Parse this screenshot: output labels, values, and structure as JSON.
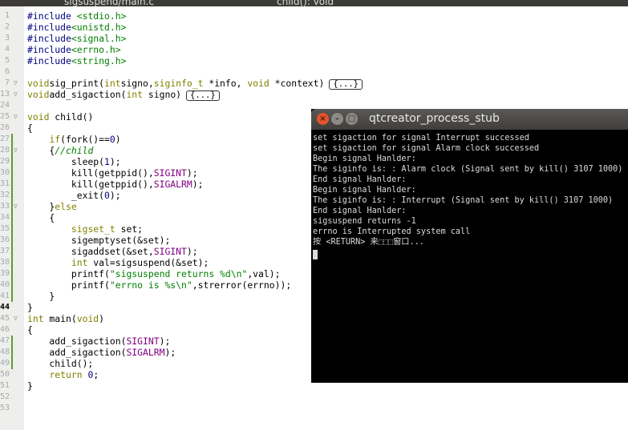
{
  "top_bar": {
    "file_tab": "sigsuspend/main.c",
    "symbol_tab": "child(): void"
  },
  "editor": {
    "collapsed_marker": "{...}",
    "lines": [
      {
        "n": "1",
        "t": [
          [
            "pp",
            "#include "
          ],
          [
            "str",
            "<stdio.h>"
          ]
        ]
      },
      {
        "n": "2",
        "t": [
          [
            "pp",
            "#include"
          ],
          [
            "str",
            "<unistd.h>"
          ]
        ]
      },
      {
        "n": "3",
        "t": [
          [
            "pp",
            "#include"
          ],
          [
            "str",
            "<signal.h>"
          ]
        ]
      },
      {
        "n": "4",
        "t": [
          [
            "pp",
            "#include"
          ],
          [
            "str",
            "<errno.h>"
          ]
        ]
      },
      {
        "n": "5",
        "t": [
          [
            "pp",
            "#include"
          ],
          [
            "str",
            "<string.h>"
          ]
        ]
      },
      {
        "n": "6",
        "t": []
      },
      {
        "n": "7",
        "fold": true,
        "t": [
          [
            "kw",
            "void"
          ],
          [
            "",
            "sig_print("
          ],
          [
            "kw",
            "int"
          ],
          [
            "",
            "signo,"
          ],
          [
            "kw",
            "siginfo_t"
          ],
          [
            "",
            " *info, "
          ],
          [
            "kw",
            "void"
          ],
          [
            "",
            " *context)"
          ]
        ],
        "collapsed": true
      },
      {
        "n": "13",
        "fold": true,
        "t": [
          [
            "kw",
            "void"
          ],
          [
            "",
            "add_sigaction("
          ],
          [
            "kw",
            "int"
          ],
          [
            "",
            " signo)"
          ]
        ],
        "collapsed": true
      },
      {
        "n": "24",
        "t": []
      },
      {
        "n": "25",
        "fold": true,
        "t": [
          [
            "kw",
            "void"
          ],
          [
            "",
            " child()"
          ]
        ]
      },
      {
        "n": "26",
        "t": [
          [
            "",
            "{"
          ]
        ]
      },
      {
        "n": "27",
        "chg": true,
        "t": [
          [
            "",
            "    "
          ],
          [
            "kw",
            "if"
          ],
          [
            "",
            "(fork()=="
          ],
          [
            "num",
            "0"
          ],
          [
            "",
            ")"
          ]
        ]
      },
      {
        "n": "28",
        "chg": true,
        "fold": true,
        "t": [
          [
            "",
            "    {"
          ],
          [
            "cm",
            "//child"
          ]
        ]
      },
      {
        "n": "29",
        "chg": true,
        "t": [
          [
            "",
            "        sleep("
          ],
          [
            "num",
            "1"
          ],
          [
            "",
            ");"
          ]
        ]
      },
      {
        "n": "30",
        "chg": true,
        "t": [
          [
            "",
            "        kill(getppid(),"
          ],
          [
            "mac",
            "SIGINT"
          ],
          [
            "",
            ");"
          ]
        ]
      },
      {
        "n": "31",
        "chg": true,
        "t": [
          [
            "",
            "        kill(getppid(),"
          ],
          [
            "mac",
            "SIGALRM"
          ],
          [
            "",
            ");"
          ]
        ]
      },
      {
        "n": "32",
        "chg": true,
        "t": [
          [
            "",
            "        _exit("
          ],
          [
            "num",
            "0"
          ],
          [
            "",
            ");"
          ]
        ]
      },
      {
        "n": "33",
        "chg": true,
        "fold": true,
        "t": [
          [
            "",
            "    }"
          ],
          [
            "kw",
            "else"
          ]
        ]
      },
      {
        "n": "34",
        "chg": true,
        "t": [
          [
            "",
            "    {"
          ]
        ]
      },
      {
        "n": "35",
        "chg": true,
        "t": [
          [
            "",
            "        "
          ],
          [
            "kw",
            "sigset_t"
          ],
          [
            "",
            " set;"
          ]
        ]
      },
      {
        "n": "36",
        "chg": true,
        "t": [
          [
            "",
            "        sigemptyset(&set);"
          ]
        ]
      },
      {
        "n": "37",
        "chg": true,
        "t": [
          [
            "",
            "        sigaddset(&set,"
          ],
          [
            "mac",
            "SIGINT"
          ],
          [
            "",
            ");"
          ]
        ]
      },
      {
        "n": "38",
        "chg": true,
        "t": [
          [
            "",
            "        "
          ],
          [
            "kw",
            "int"
          ],
          [
            "",
            " val=sigsuspend(&set);"
          ]
        ]
      },
      {
        "n": "39",
        "chg": true,
        "t": [
          [
            "",
            "        printf("
          ],
          [
            "str",
            "\"sigsuspend returns %d\\n\""
          ],
          [
            "",
            ",val);"
          ]
        ]
      },
      {
        "n": "40",
        "chg": true,
        "t": [
          [
            "",
            "        printf("
          ],
          [
            "str",
            "\"errno is %s\\n\""
          ],
          [
            "",
            ",strerror(errno));"
          ]
        ]
      },
      {
        "n": "41",
        "chg": true,
        "t": [
          [
            "",
            "    }"
          ]
        ]
      },
      {
        "n": "44",
        "cur": true,
        "t": [
          [
            "",
            "}"
          ]
        ]
      },
      {
        "n": "45",
        "fold": true,
        "t": [
          [
            "kw",
            "int"
          ],
          [
            "",
            " main("
          ],
          [
            "kw",
            "void"
          ],
          [
            "",
            ")"
          ]
        ]
      },
      {
        "n": "46",
        "t": [
          [
            "",
            "{"
          ]
        ]
      },
      {
        "n": "47",
        "chg": true,
        "t": [
          [
            "",
            "    add_sigaction("
          ],
          [
            "mac",
            "SIGINT"
          ],
          [
            "",
            ");"
          ]
        ]
      },
      {
        "n": "48",
        "chg": true,
        "t": [
          [
            "",
            "    add_sigaction("
          ],
          [
            "mac",
            "SIGALRM"
          ],
          [
            "",
            ");"
          ]
        ]
      },
      {
        "n": "49",
        "chg": true,
        "t": [
          [
            "",
            "    child();"
          ]
        ]
      },
      {
        "n": "50",
        "t": [
          [
            "",
            "    "
          ],
          [
            "kw",
            "return"
          ],
          [
            "",
            " "
          ],
          [
            "num",
            "0"
          ],
          [
            "",
            ";"
          ]
        ]
      },
      {
        "n": "51",
        "t": [
          [
            "",
            "}"
          ]
        ]
      },
      {
        "n": "52",
        "t": []
      },
      {
        "n": "53",
        "t": []
      }
    ]
  },
  "terminal": {
    "title": "qtcreator_process_stub",
    "buttons": {
      "close": "×",
      "minimize": "–",
      "maximize": "□"
    },
    "lines": [
      "set sigaction for signal Interrupt successed",
      "set sigaction for signal Alarm clock successed",
      "Begin signal Hanlder:",
      "The siginfo is: : Alarm clock (Signal sent by kill() 3107 1000)",
      "End signal Hanlder:",
      "Begin signal Hanlder:",
      "The siginfo is: : Interrupt (Signal sent by kill() 3107 1000)",
      "End signal Hanlder:",
      "sigsuspend returns -1",
      "errno is Interrupted system call",
      "按 <RETURN> 来⬚⬚⬚窗口..."
    ]
  }
}
